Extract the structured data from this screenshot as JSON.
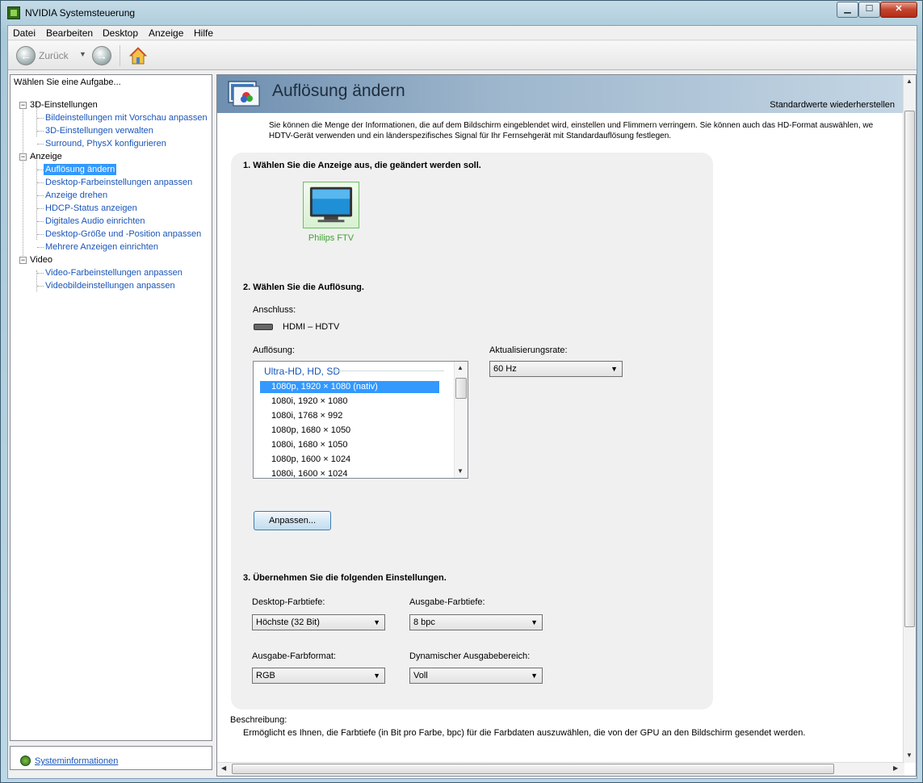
{
  "window": {
    "title": "NVIDIA Systemsteuerung"
  },
  "menu": [
    "Datei",
    "Bearbeiten",
    "Desktop",
    "Anzeige",
    "Hilfe"
  ],
  "toolbar": {
    "back_label": "Zurück"
  },
  "left": {
    "header": "Wählen Sie eine Aufgabe...",
    "tree": [
      {
        "label": "3D-Einstellungen",
        "children": [
          "Bildeinstellungen mit Vorschau anpassen",
          "3D-Einstellungen verwalten",
          "Surround, PhysX konfigurieren"
        ]
      },
      {
        "label": "Anzeige",
        "children": [
          "Auflösung ändern",
          "Desktop-Farbeinstellungen anpassen",
          "Anzeige drehen",
          "HDCP-Status anzeigen",
          "Digitales Audio einrichten",
          "Desktop-Größe und -Position anpassen",
          "Mehrere Anzeigen einrichten"
        ]
      },
      {
        "label": "Video",
        "children": [
          "Video-Farbeinstellungen anpassen",
          "Videobildeinstellungen anpassen"
        ]
      }
    ],
    "selected": "Auflösung ändern",
    "sysinfo": "Systeminformationen"
  },
  "page": {
    "title": "Auflösung ändern",
    "reset": "Standardwerte wiederherstellen",
    "description_line1": "Sie können die Menge der Informationen, die auf dem Bildschirm eingeblendet wird, einstellen und Flimmern verringern. Sie können auch das HD-Format auswählen, we",
    "description_line2": "HDTV-Gerät verwenden und ein länderspezifisches Signal für Ihr Fernsehgerät mit Standardauflösung festlegen.",
    "step1": "1. Wählen Sie die Anzeige aus, die geändert werden soll.",
    "display_name": "Philips FTV",
    "step2": "2. Wählen Sie die Auflösung.",
    "connector_label": "Anschluss:",
    "connector_value": "HDMI – HDTV",
    "resolution_label": "Auflösung:",
    "resolution_group": "Ultra-HD, HD, SD",
    "resolutions": [
      "1080p, 1920 × 1080 (nativ)",
      "1080i, 1920 × 1080",
      "1080i, 1768 × 992",
      "1080p, 1680 × 1050",
      "1080i, 1680 × 1050",
      "1080p, 1600 × 1024",
      "1080i, 1600 × 1024"
    ],
    "refresh_label": "Aktualisierungsrate:",
    "refresh_value": "60 Hz",
    "customize_button": "Anpassen...",
    "step3": "3. Übernehmen Sie die folgenden Einstellungen.",
    "desktop_depth_label": "Desktop-Farbtiefe:",
    "desktop_depth_value": "Höchste (32 Bit)",
    "output_depth_label": "Ausgabe-Farbtiefe:",
    "output_depth_value": "8 bpc",
    "output_format_label": "Ausgabe-Farbformat:",
    "output_format_value": "RGB",
    "dynamic_range_label": "Dynamischer Ausgabebereich:",
    "dynamic_range_value": "Voll",
    "desc_heading": "Beschreibung:",
    "desc_text": "Ermöglicht es Ihnen, die Farbtiefe (in Bit pro Farbe, bpc) für die Farbdaten auszuwählen, die von der GPU an den Bildschirm gesendet werden."
  }
}
